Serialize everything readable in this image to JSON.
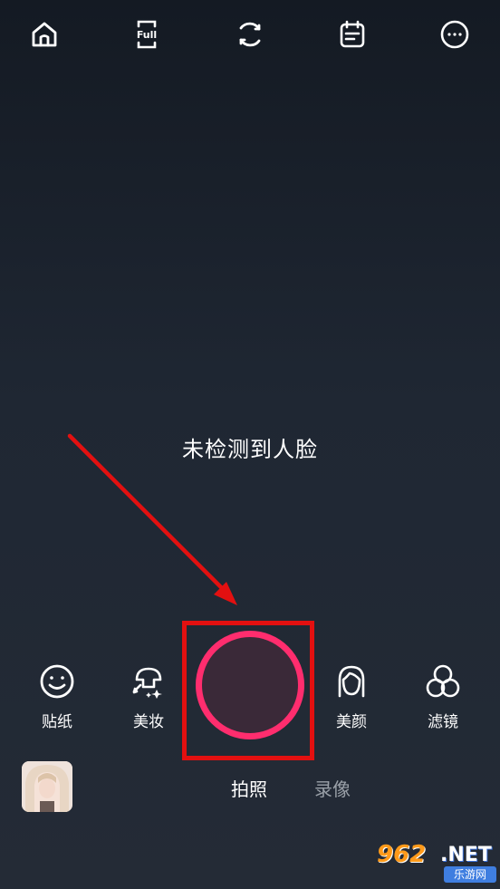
{
  "top_bar": {
    "icons": [
      "home-icon",
      "fullscreen-icon",
      "switch-camera-icon",
      "notes-icon",
      "more-icon"
    ],
    "full_label": "Full"
  },
  "center_prompt": "未检测到人脸",
  "tools": {
    "sticker": {
      "label": "贴纸",
      "icon": "smiley-icon"
    },
    "makeup": {
      "label": "美妆",
      "icon": "makeup-icon"
    },
    "beauty": {
      "label": "美颜",
      "icon": "face-icon"
    },
    "filter": {
      "label": "滤镜",
      "icon": "filter-icon"
    }
  },
  "modes": {
    "photo": "拍照",
    "video": "录像",
    "active": "photo"
  },
  "watermark": {
    "number": "962",
    "domain": ".NET",
    "subtitle": "乐游网"
  },
  "colors": {
    "shutter_ring": "#ff2d6e",
    "annotation": "#e31010",
    "inactive_mode": "#9aa0a8"
  }
}
